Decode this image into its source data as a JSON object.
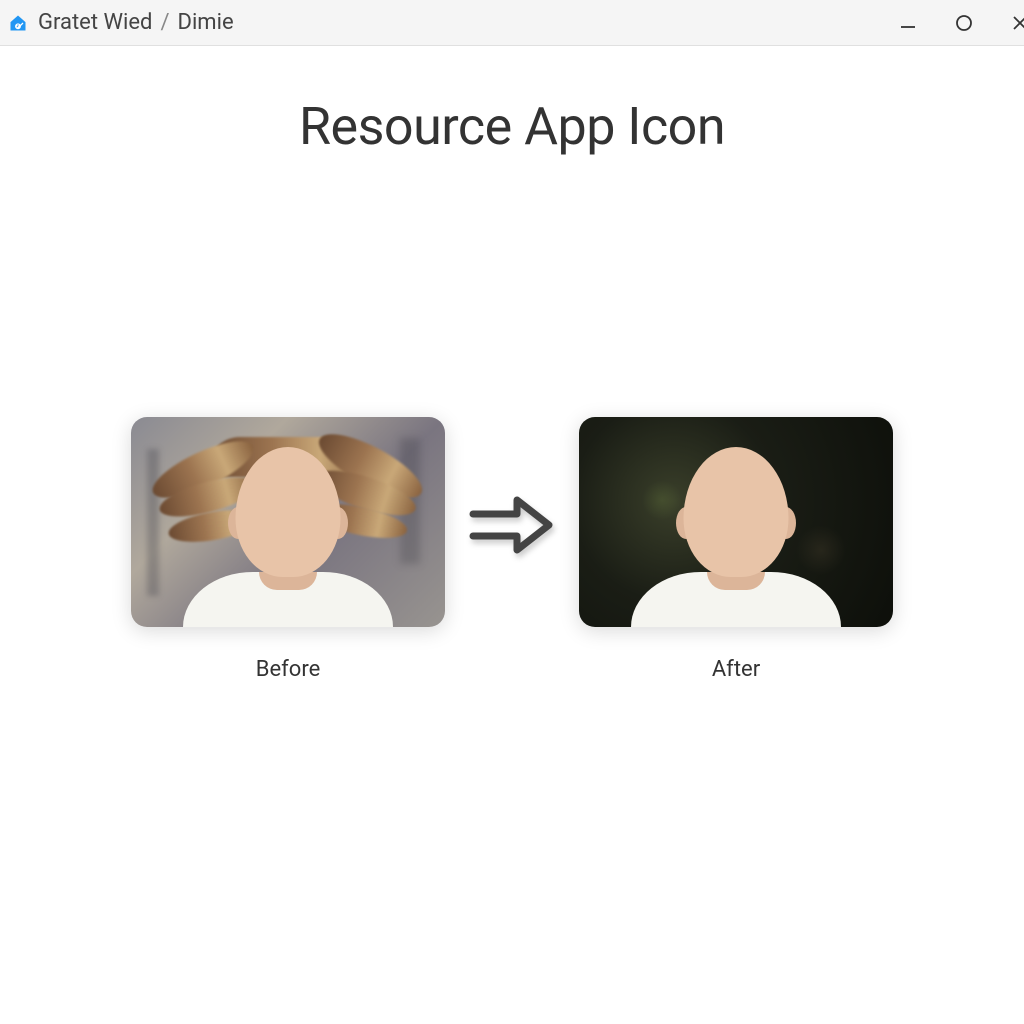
{
  "titlebar": {
    "breadcrumb_parent": "Gratet Wied",
    "breadcrumb_sep": "/",
    "breadcrumb_current": "Dimie"
  },
  "page": {
    "title": "Resource App Icon"
  },
  "comparison": {
    "before_label": "Before",
    "after_label": "After"
  }
}
